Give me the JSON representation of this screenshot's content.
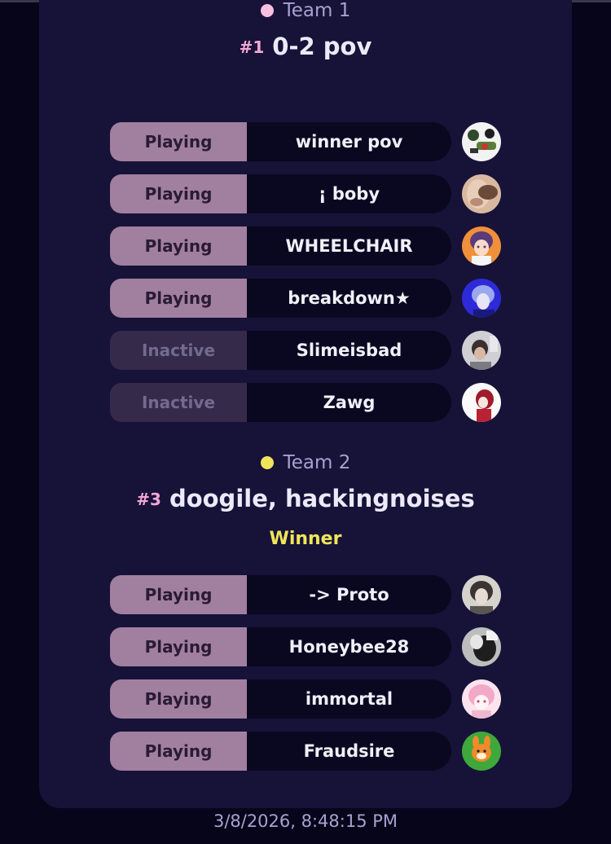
{
  "teams": [
    {
      "label": "Team 1",
      "dot_color": "#f7bfe0",
      "rank": "#1",
      "name": "0-2 pov",
      "winner_text": "",
      "players": [
        {
          "status": "Playing",
          "name": "winner pov",
          "avatar": "avatar-image"
        },
        {
          "status": "Playing",
          "name": "¡ boby",
          "avatar": "avatar-image"
        },
        {
          "status": "Playing",
          "name": "WHEELCHAIR",
          "avatar": "avatar-image"
        },
        {
          "status": "Playing",
          "name": "breakdown★",
          "avatar": "avatar-image"
        },
        {
          "status": "Inactive",
          "name": "Slimeisbad",
          "avatar": "avatar-image"
        },
        {
          "status": "Inactive",
          "name": "Zawg",
          "avatar": "avatar-image"
        }
      ]
    },
    {
      "label": "Team 2",
      "dot_color": "#f0e55a",
      "rank": "#3",
      "name": "doogile, hackingnoises",
      "winner_text": "Winner",
      "players": [
        {
          "status": "Playing",
          "name": "-> Proto",
          "avatar": "avatar-image"
        },
        {
          "status": "Playing",
          "name": "Honeybee28",
          "avatar": "avatar-image"
        },
        {
          "status": "Playing",
          "name": "immortal",
          "avatar": "avatar-image"
        },
        {
          "status": "Playing",
          "name": "Fraudsire",
          "avatar": "avatar-image"
        }
      ]
    }
  ],
  "timestamp": "3/8/2026, 8:48:15 PM",
  "colors": {
    "background": "#07051a",
    "card": "#171238",
    "playing_pill": "#a17f9f",
    "inactive_pill": "#352a4a",
    "name_pill": "#0a0820",
    "rank": "#f3a7d6",
    "winner": "#f0e55a"
  }
}
